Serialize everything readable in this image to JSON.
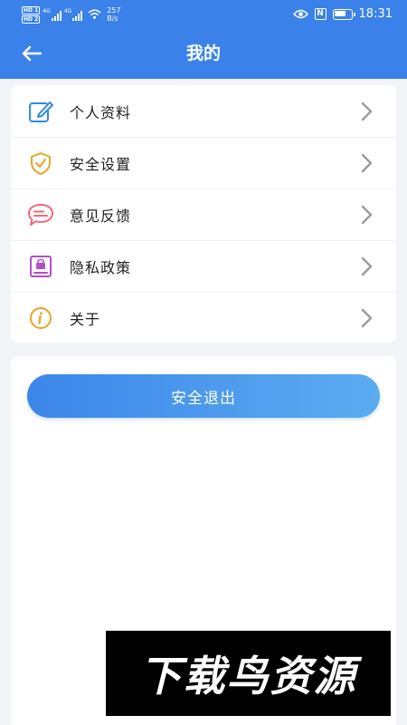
{
  "status_bar": {
    "hd_top": "HD 1",
    "hd_bottom": "HD 2",
    "network_1": "4G",
    "network_2": "4G",
    "speed_value": "257",
    "speed_unit": "B/s",
    "nfc": "N",
    "battery_level": 0.75,
    "time": "18:31"
  },
  "header": {
    "title": "我的",
    "back_icon": "arrow-left-icon"
  },
  "menu": {
    "items": [
      {
        "label": "个人资料",
        "icon": "edit-profile-icon",
        "icon_color": "#2f8be0"
      },
      {
        "label": "安全设置",
        "icon": "shield-check-icon",
        "icon_color": "#e6a52a"
      },
      {
        "label": "意见反馈",
        "icon": "feedback-bubble-icon",
        "icon_color": "#ef6a7a"
      },
      {
        "label": "隐私政策",
        "icon": "privacy-lock-icon",
        "icon_color": "#b44fc8"
      },
      {
        "label": "关于",
        "icon": "info-icon",
        "icon_color": "#e6a52a"
      }
    ]
  },
  "logout": {
    "label": "安全退出"
  },
  "watermark": {
    "text": "下载鸟资源"
  },
  "colors": {
    "primary": "#3a82ea",
    "background": "#f3f4f8",
    "chevron": "#9a9a9a"
  }
}
